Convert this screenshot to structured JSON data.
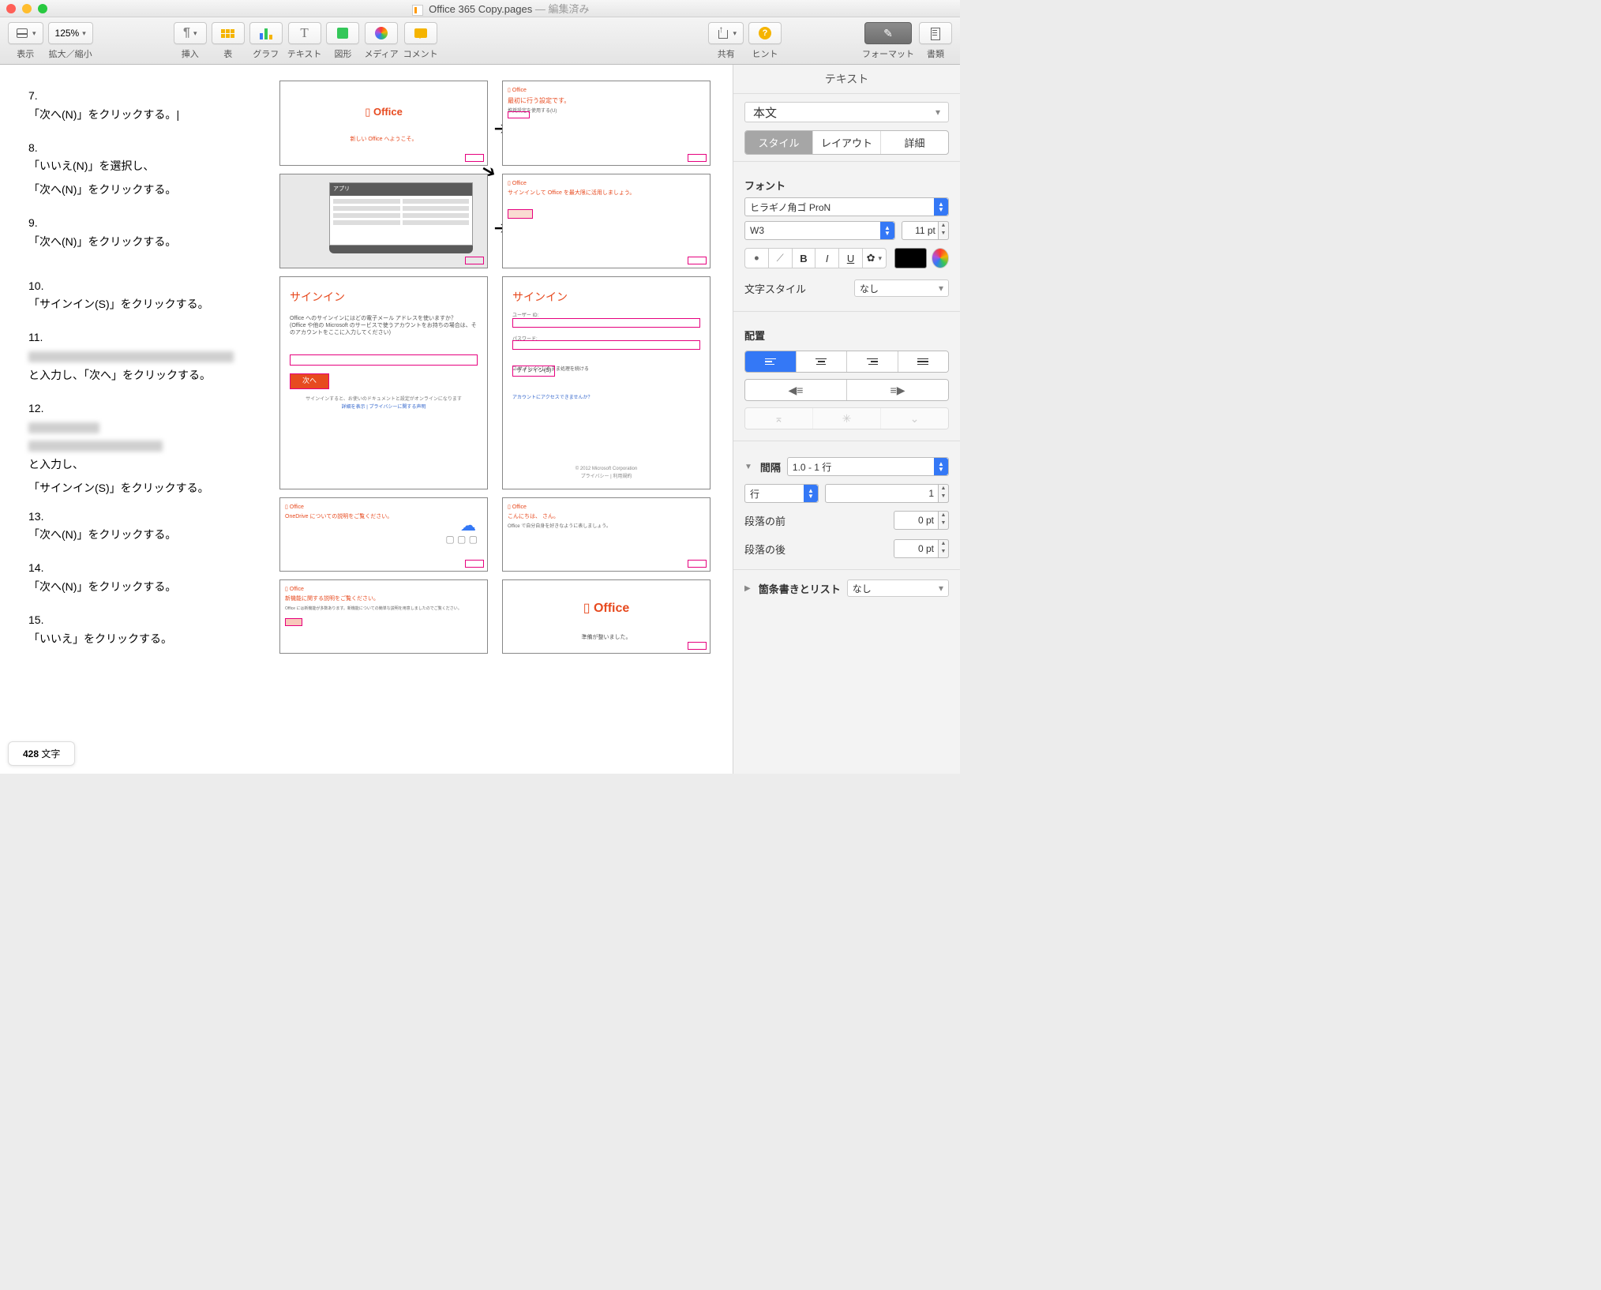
{
  "window": {
    "filename": "Office 365 Copy.pages",
    "status": "編集済み"
  },
  "toolbar": {
    "view": "表示",
    "zoom_value": "125%",
    "zoom": "拡大／縮小",
    "insert": "挿入",
    "table": "表",
    "chart": "グラフ",
    "text": "テキスト",
    "shape": "図形",
    "media": "メディア",
    "comment": "コメント",
    "share": "共有",
    "hint": "ヒント",
    "format": "フォーマット",
    "document": "書類"
  },
  "doc": {
    "steps": [
      {
        "num": "7.",
        "text": "「次へ(N)」をクリックする。"
      },
      {
        "num": "8.",
        "text": "「いいえ(N)」を選択し、",
        "text2": "「次へ(N)」をクリックする。"
      },
      {
        "num": "9.",
        "text": "「次へ(N)」をクリックする。"
      },
      {
        "num": "10.",
        "text": "「サインイン(S)」をクリックする。"
      },
      {
        "num": "11.",
        "suffix": "と入力し、「次へ」をクリックする。",
        "redacted": true
      },
      {
        "num": "12.",
        "suffix": "と入力し、",
        "text2": "「サインイン(S)」をクリックする。",
        "redacted": true
      },
      {
        "num": "13.",
        "text": "「次へ(N)」をクリックする。"
      },
      {
        "num": "14.",
        "text": "「次へ(N)」をクリックする。"
      },
      {
        "num": "15.",
        "text": "「いいえ」をクリックする。"
      }
    ],
    "thumbs": {
      "t1": {
        "logo": "Office",
        "welcome": "新しい Office へようこそ。"
      },
      "t2": {
        "brand": "Office",
        "title": "最初に行う設定です。",
        "sub": "推奨設定を使用する(U)"
      },
      "t3": {
        "title": "アプリ"
      },
      "t4": {
        "brand": "Office",
        "title": "サインインして Office を最大限に活用しましょう。"
      },
      "t5": {
        "title": "サインイン",
        "desc1": "Office へのサインインにはどの電子メール アドレスを使いますか？",
        "desc2": "(Office や他の Microsoft のサービスで使うアカウントをお持ちの場合は、そのアカウントをここに入力してください)",
        "btn": "次へ",
        "foot1": "サインインすると、お使いのドキュメントと設定がオンラインになります",
        "foot2": "詳細を表示  |  プライバシーに関する声明"
      },
      "t6": {
        "title": "サインイン",
        "label1": "ユーザー ID:",
        "label2": "パスワード:",
        "chk": "サインインしたまま処理を続ける",
        "btn": "サインイン(S)",
        "link": "アカウントにアクセスできませんか？",
        "copy": "© 2012 Microsoft Corporation",
        "copy2": "プライバシー  |  利用規約"
      },
      "t7": {
        "brand": "Office",
        "title": "OneDrive についての説明をご覧ください。"
      },
      "t8": {
        "brand": "Office",
        "title": "こんにちは、          さん。",
        "sub": "Office で自分自身を好きなように表しましょう。"
      },
      "t9": {
        "brand": "Office",
        "title": "新機能に関する説明をご覧ください。",
        "sub": "Office には新機能が多数あります。新機能についての簡単な説明を用意しましたのでご覧ください。"
      },
      "t10": {
        "logo": "Office",
        "title": "準備が整いました。"
      }
    },
    "wordcount_num": "428",
    "wordcount_label": " 文字"
  },
  "inspector": {
    "title": "テキスト",
    "paragraph_style": "本文",
    "tabs": {
      "style": "スタイル",
      "layout": "レイアウト",
      "more": "詳細"
    },
    "font": {
      "header": "フォント",
      "family": "ヒラギノ角ゴ ProN",
      "weight": "W3",
      "size": "11 pt",
      "bold": "B",
      "italic": "I",
      "underline": "U",
      "charstyle_label": "文字スタイル",
      "charstyle_value": "なし"
    },
    "align": {
      "header": "配置"
    },
    "spacing": {
      "header": "間隔",
      "preset": "1.0 - 1 行",
      "line_label": "行",
      "line_value": "1",
      "before_label": "段落の前",
      "before_value": "0 pt",
      "after_label": "段落の後",
      "after_value": "0 pt"
    },
    "bullets": {
      "header": "箇条書きとリスト",
      "value": "なし"
    }
  }
}
